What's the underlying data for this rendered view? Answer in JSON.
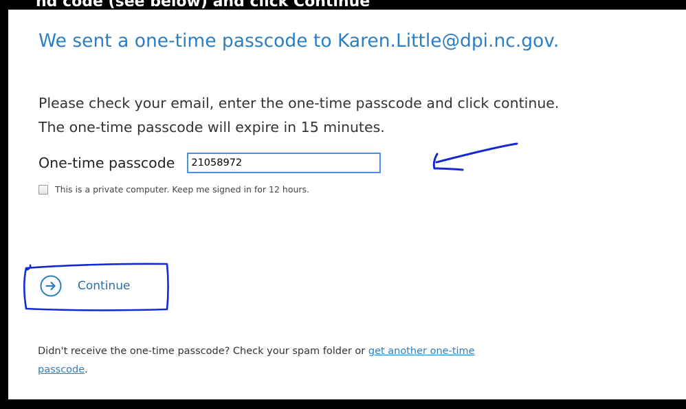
{
  "top_fragment": "nd code (see below) and click Continue",
  "heading": "We sent a one-time passcode to Karen.Little@dpi.nc.gov.",
  "instructions": {
    "line1": "Please check your email, enter the one-time passcode and click continue.",
    "line2": "The one-time passcode will expire in 15 minutes."
  },
  "passcode": {
    "label": "One-time passcode",
    "value": "21058972"
  },
  "remember": {
    "label": "This is a private computer. Keep me signed in for 12 hours.",
    "checked": false
  },
  "continue_button": {
    "label": "Continue"
  },
  "footer": {
    "text": "Didn't receive the one-time passcode? Check your spam folder or ",
    "link_part1": "get another one-time",
    "link_part2": "passcode",
    "end": "."
  },
  "colors": {
    "heading": "#2a7fc4",
    "link": "#2a7fc4",
    "annotation": "#1428d4",
    "input_border": "#4a90e2"
  }
}
